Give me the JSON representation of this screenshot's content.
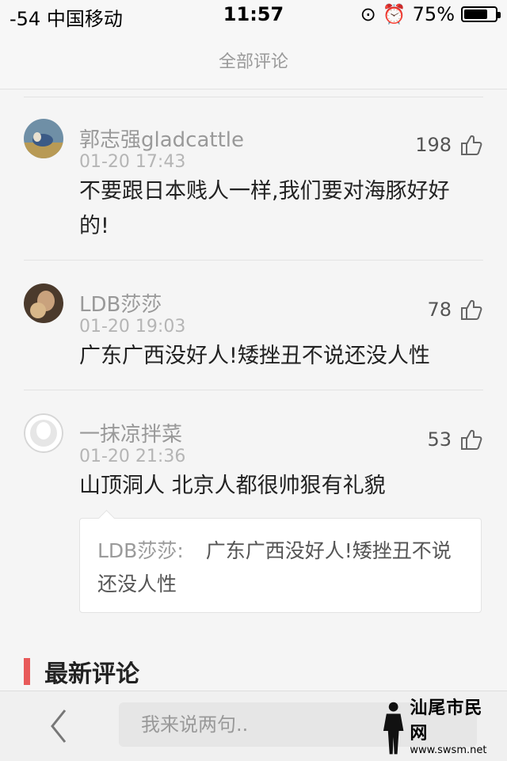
{
  "status_bar": {
    "signal": "-54 中国移动",
    "time": "11:57",
    "battery": "75%",
    "battery_level": 0.75
  },
  "nav": {
    "title": "全部评论"
  },
  "comments": [
    {
      "name": "郭志强gladcattle",
      "time": "01-20 17:43",
      "likes": "198",
      "text": "不要跟日本贱人一样,我们要对海豚好好的!"
    },
    {
      "name": "LDB莎莎",
      "time": "01-20 19:03",
      "likes": "78",
      "text": "广东广西没好人!矮挫丑不说还没人性"
    },
    {
      "name": "一抹凉拌菜",
      "time": "01-20 21:36",
      "likes": "53",
      "text": "山顶洞人 北京人都很帅狠有礼貌"
    }
  ],
  "quote": {
    "name": "LDB莎莎:",
    "text": "广东广西没好人!矮挫丑不说还没人性"
  },
  "section": {
    "title": "最新评论"
  },
  "bottom_bar": {
    "input_placeholder": "我来说两句.."
  },
  "watermark": {
    "name": "汕尾市民网",
    "url": "www.swsm.net"
  },
  "colors": {
    "accent": "#e85a5a"
  }
}
